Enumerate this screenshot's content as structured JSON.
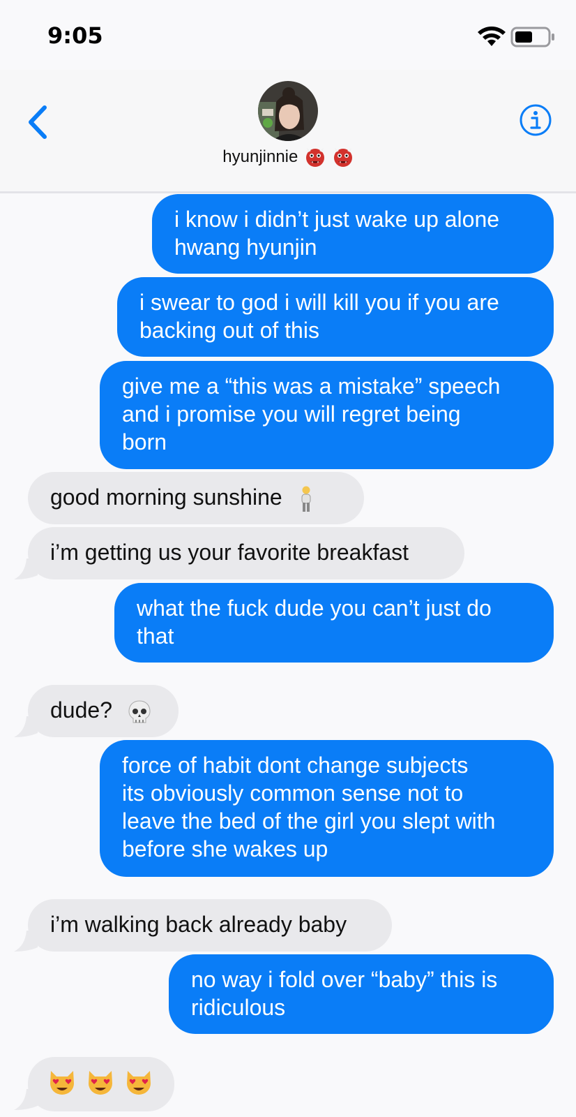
{
  "status_bar": {
    "time": "9:05"
  },
  "header": {
    "contact_name": "hyunjinnie",
    "contact_emojis": [
      "ogre-face",
      "ogre-face"
    ]
  },
  "messages": [
    {
      "from": "me",
      "text": "i know i didn’t just wake up alone\nhwang hyunjin"
    },
    {
      "from": "me",
      "text": "i swear to god i will kill you if you are\nbacking out of this"
    },
    {
      "from": "me",
      "text": "give me a “this was a mistake” speech\nand i promise you will regret being\nborn"
    },
    {
      "from": "them",
      "text": "good morning sunshine",
      "emoji": "person-standing"
    },
    {
      "from": "them",
      "text": "i’m getting us your favorite breakfast"
    },
    {
      "from": "me",
      "text": "what the fuck dude you can’t just do\nthat"
    },
    {
      "from": "them",
      "text": "dude?",
      "emoji": "skull"
    },
    {
      "from": "me",
      "text": "force of habit dont change subjects\nits obviously common sense not to\nleave the bed of the girl you slept with\nbefore she wakes up"
    },
    {
      "from": "them",
      "text": "i’m walking back already baby"
    },
    {
      "from": "me",
      "text": "no way i fold over “baby” this is\nridiculous"
    },
    {
      "from": "them",
      "text": "",
      "emoji": "heart-eyes-cat x3"
    }
  ],
  "colors": {
    "sent_bubble": "#0a7df7",
    "received_bubble": "#e9e9ec",
    "accent": "#0a7df7"
  }
}
